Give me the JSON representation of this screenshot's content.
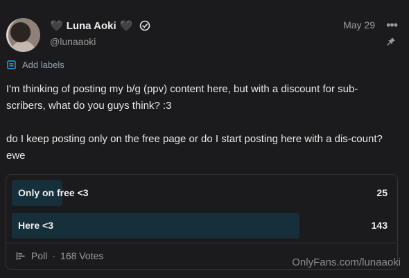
{
  "author": {
    "name": "Luna Aoki",
    "heart_left": "🖤",
    "heart_right": "🖤",
    "handle": "@lunaaoki",
    "verified": true
  },
  "post": {
    "date": "May 29",
    "more_label": "•••",
    "add_labels": "Add labels",
    "paragraphs": [
      "I'm thinking of posting my b/g (ppv) content here, but with a discount for sub-scribers, what do you guys think? :3",
      "do I keep posting only on the free page or do I start posting here with a dis-count? ewe"
    ]
  },
  "poll": {
    "options": [
      {
        "label": "Only on free <3",
        "votes": "25",
        "fraction": 0.149
      },
      {
        "label": "Here <3",
        "votes": "143",
        "fraction": 0.851
      }
    ],
    "footer_label": "Poll",
    "separator": "·",
    "total_votes": "168 Votes"
  },
  "watermark": "OnlyFans.com/lunaaoki",
  "colors": {
    "accent": "#00aff0",
    "bar": "#15303a",
    "background": "#1b1b1d"
  }
}
